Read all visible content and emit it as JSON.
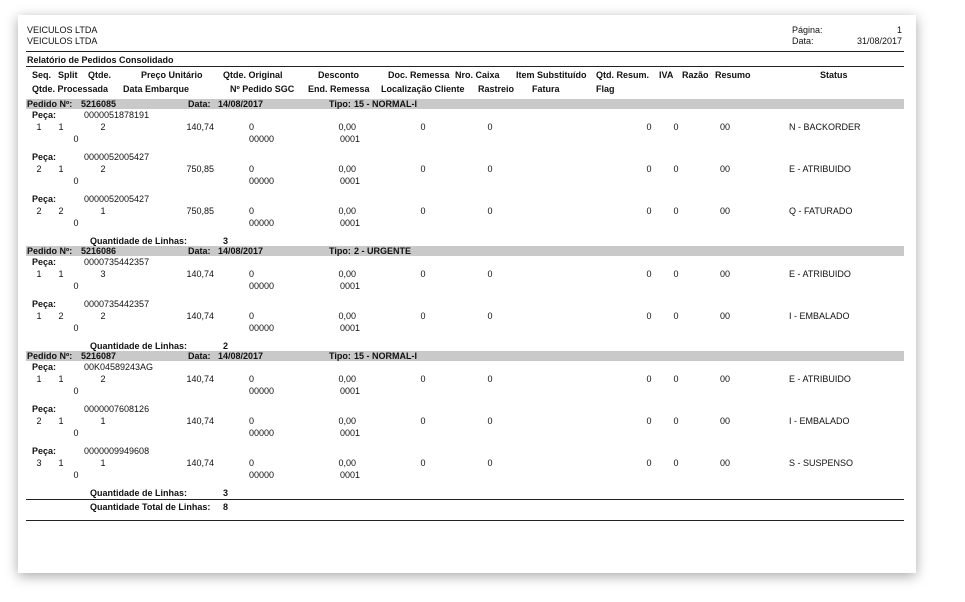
{
  "header": {
    "company_line1": "VEICULOS LTDA",
    "company_line2": "VEICULOS LTDA",
    "page_label": "Página:",
    "page_value": "1",
    "date_label": "Data:",
    "date_value": "31/08/2017",
    "report_title": "Relatório de Pedidos Consolidado"
  },
  "columns": {
    "row1": [
      "Seq.",
      "Split",
      "Qtde.",
      "Preço Unitário",
      "Qtde. Original",
      "Desconto",
      "Doc. Remessa",
      "Nro. Caixa",
      "Item Substituído",
      "Qtd. Resum.",
      "IVA",
      "Razão",
      "Resumo",
      "Status"
    ],
    "row2": [
      "Qtde. Processada",
      "Data Embarque",
      "Nº Pedido SGC",
      "End. Remessa",
      "Localização Cliente",
      "Rastreio",
      "Fatura",
      "Flag"
    ]
  },
  "labels": {
    "order": "Pedido Nº:",
    "date": "Data:",
    "type": "Tipo:",
    "piece": "Peça:",
    "line_count": "Quantidade de Linhas:",
    "total_count": "Quantidade Total de Linhas:"
  },
  "orders": [
    {
      "number": "5216085",
      "date": "14/08/2017",
      "type": "15 - NORMAL-I",
      "line_count": "3",
      "pieces": [
        {
          "code": "0000051878191",
          "seq": "1",
          "split": "1",
          "qty": "2",
          "price": "140,74",
          "orig_qty": "0",
          "discount": "0,00",
          "doc": "0",
          "box": "0",
          "qtd_resum": "0",
          "iva": "0",
          "razao": "00",
          "status": "N - BACKORDER",
          "processed": "0",
          "sgc": "00000",
          "end_remessa": "0001"
        },
        {
          "code": "0000052005427",
          "seq": "2",
          "split": "1",
          "qty": "2",
          "price": "750,85",
          "orig_qty": "0",
          "discount": "0,00",
          "doc": "0",
          "box": "0",
          "qtd_resum": "0",
          "iva": "0",
          "razao": "00",
          "status": "E - ATRIBUIDO",
          "processed": "0",
          "sgc": "00000",
          "end_remessa": "0001"
        },
        {
          "code": "0000052005427",
          "seq": "2",
          "split": "2",
          "qty": "1",
          "price": "750,85",
          "orig_qty": "0",
          "discount": "0,00",
          "doc": "0",
          "box": "0",
          "qtd_resum": "0",
          "iva": "0",
          "razao": "00",
          "status": "Q - FATURADO",
          "processed": "0",
          "sgc": "00000",
          "end_remessa": "0001"
        }
      ]
    },
    {
      "number": "5216086",
      "date": "14/08/2017",
      "type": "2 - URGENTE",
      "line_count": "2",
      "pieces": [
        {
          "code": "0000735442357",
          "seq": "1",
          "split": "1",
          "qty": "3",
          "price": "140,74",
          "orig_qty": "0",
          "discount": "0,00",
          "doc": "0",
          "box": "0",
          "qtd_resum": "0",
          "iva": "0",
          "razao": "00",
          "status": "E - ATRIBUIDO",
          "processed": "0",
          "sgc": "00000",
          "end_remessa": "0001"
        },
        {
          "code": "0000735442357",
          "seq": "1",
          "split": "2",
          "qty": "2",
          "price": "140,74",
          "orig_qty": "0",
          "discount": "0,00",
          "doc": "0",
          "box": "0",
          "qtd_resum": "0",
          "iva": "0",
          "razao": "00",
          "status": "I - EMBALADO",
          "processed": "0",
          "sgc": "00000",
          "end_remessa": "0001"
        }
      ]
    },
    {
      "number": "5216087",
      "date": "14/08/2017",
      "type": "15 - NORMAL-I",
      "line_count": "3",
      "pieces": [
        {
          "code": "00K04589243AG",
          "seq": "1",
          "split": "1",
          "qty": "2",
          "price": "140,74",
          "orig_qty": "0",
          "discount": "0,00",
          "doc": "0",
          "box": "0",
          "qtd_resum": "0",
          "iva": "0",
          "razao": "00",
          "status": "E - ATRIBUIDO",
          "processed": "0",
          "sgc": "00000",
          "end_remessa": "0001"
        },
        {
          "code": "0000007608126",
          "seq": "2",
          "split": "1",
          "qty": "1",
          "price": "140,74",
          "orig_qty": "0",
          "discount": "0,00",
          "doc": "0",
          "box": "0",
          "qtd_resum": "0",
          "iva": "0",
          "razao": "00",
          "status": "I - EMBALADO",
          "processed": "0",
          "sgc": "00000",
          "end_remessa": "0001"
        },
        {
          "code": "0000009949608",
          "seq": "3",
          "split": "1",
          "qty": "1",
          "price": "140,74",
          "orig_qty": "0",
          "discount": "0,00",
          "doc": "0",
          "box": "0",
          "qtd_resum": "0",
          "iva": "0",
          "razao": "00",
          "status": "S - SUSPENSO",
          "processed": "0",
          "sgc": "00000",
          "end_remessa": "0001"
        }
      ]
    }
  ],
  "total_lines": "8"
}
